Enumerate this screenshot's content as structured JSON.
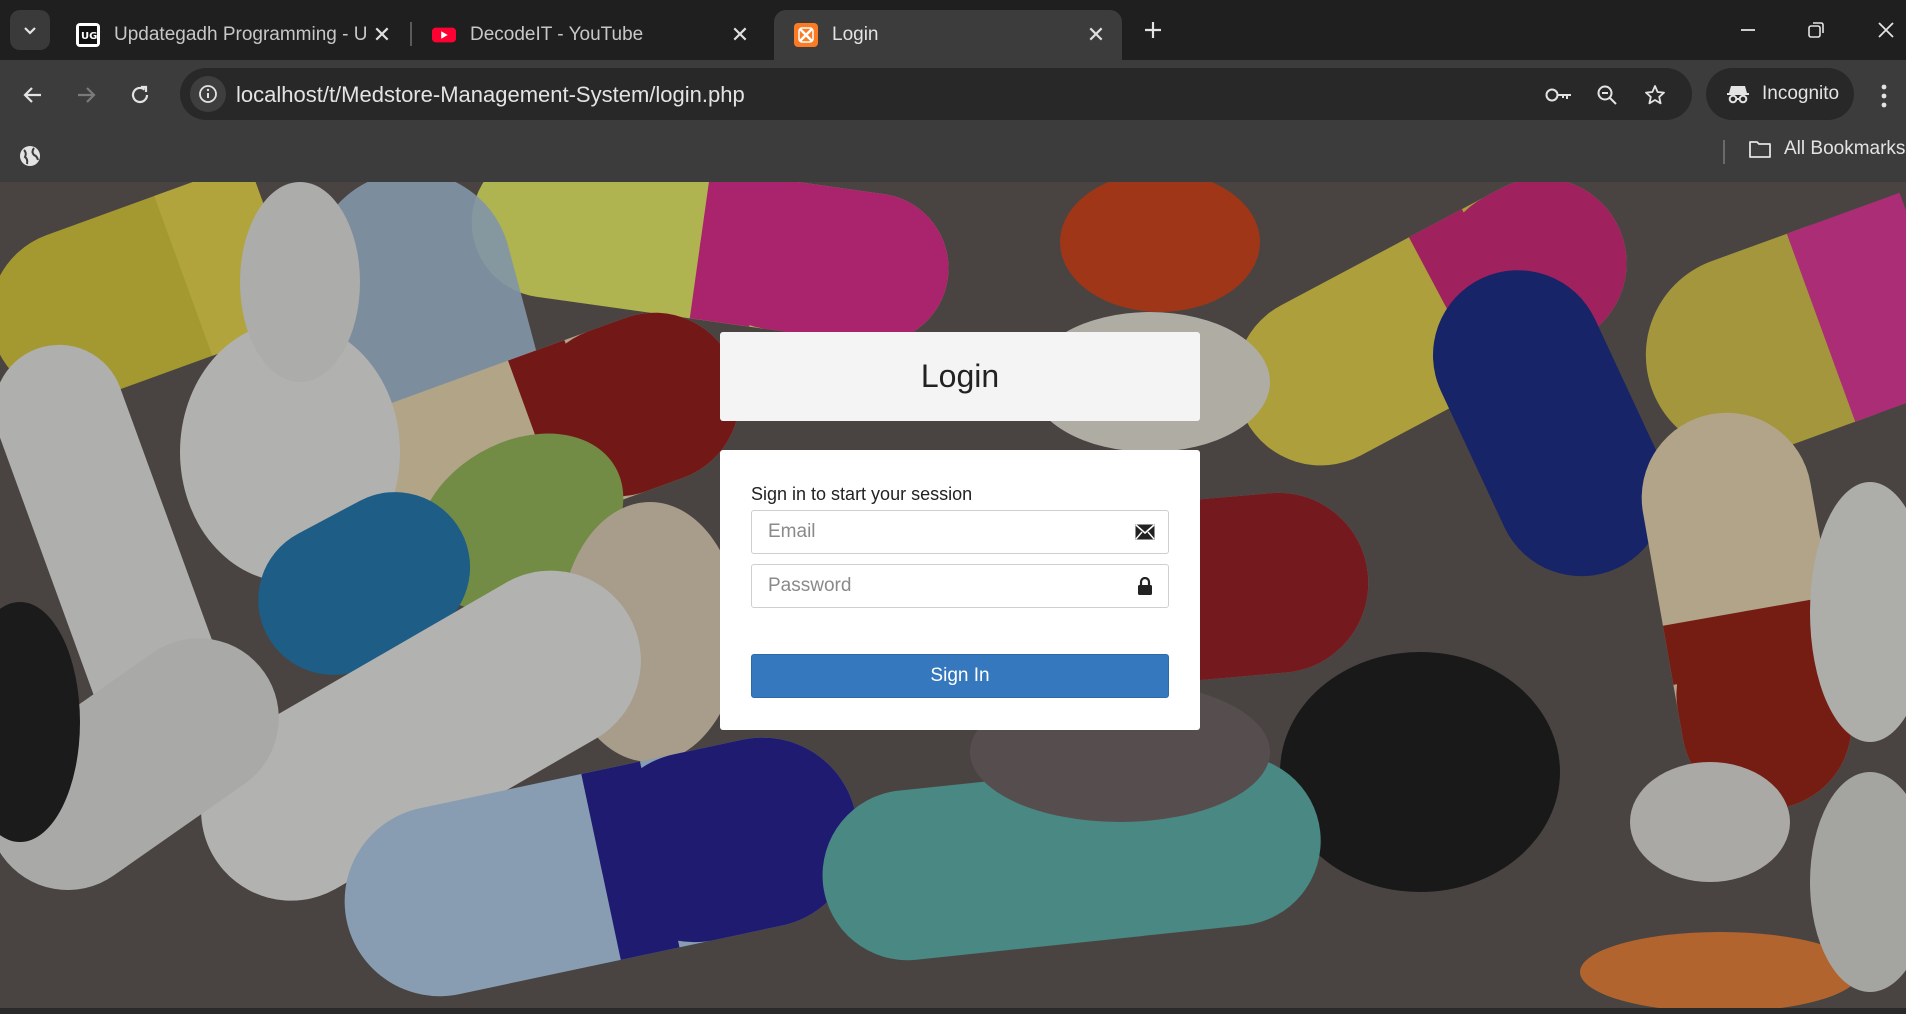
{
  "browser": {
    "tabs": [
      {
        "title": "Updategadh Programming - Up",
        "favicon": "ug-logo-icon",
        "active": false
      },
      {
        "title": "DecodeIT - YouTube",
        "favicon": "youtube-icon",
        "active": false
      },
      {
        "title": "Login",
        "favicon": "xampp-icon",
        "active": true
      }
    ],
    "url": "localhost/t/Medstore-Management-System/login.php",
    "incognito_label": "Incognito",
    "bookmarks_label": "All Bookmarks",
    "accent": "#1f1f1f"
  },
  "login": {
    "title": "Login",
    "message": "Sign in to start your session",
    "email_placeholder": "Email",
    "password_placeholder": "Password",
    "submit_label": "Sign In",
    "button_color": "#3678bd"
  }
}
